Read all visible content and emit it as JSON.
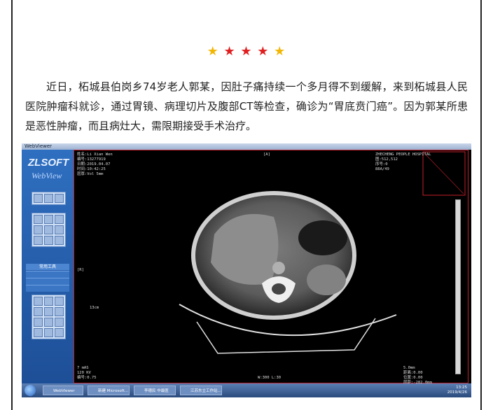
{
  "rating": {
    "stars": 5,
    "colors": [
      "#f2b705",
      "#e02020",
      "#e02020",
      "#e02020",
      "#f2b705"
    ]
  },
  "article": {
    "paragraph": "近日，柘城县伯岗乡74岁老人郭某，因肚子痛持续一个多月得不到缓解，来到柘城县人民医院肿瘤科就诊，通过胃镜、病理切片及腹部CT等检查，确诊为“胃底贲门癌”。因为郭某所患是恶性肿瘤，而且病灶大，需限期接受手术治疗。"
  },
  "ct_screenshot": {
    "window_title": "WebViewer",
    "logo_text": "ZLSOFT",
    "logo_subtext": "WebView",
    "sidebar_label": "常用工具",
    "patient_info": [
      "姓名:Li Xian Wen",
      "编号:13277919",
      "日期:2019.04.07",
      "时间:10:42:25",
      "层厚:Vol 5mm"
    ],
    "hospital_info": [
      "ZHECHENG PEOPLE HOSPITAL",
      "图:512,512",
      "序号:0",
      "88A/49"
    ],
    "top_marker": "[A]",
    "left_marker": "[R]",
    "scale_label": "13cm",
    "bottom_left_info": [
      "7 mAS",
      "120 KV",
      "编号:0.75"
    ],
    "bottom_center_info": "W:300 L:30",
    "bottom_right_info": [
      "5.0mm",
      "距离:0.00",
      "位置:0.00",
      "层距:-282.0mm"
    ],
    "taskbar_items": [
      "WebViewer",
      "新建 Microsoft...",
      "李德民 中最医院...",
      "江苏东立工作站..."
    ],
    "clock": [
      "13:25",
      "2019/4/26"
    ]
  }
}
